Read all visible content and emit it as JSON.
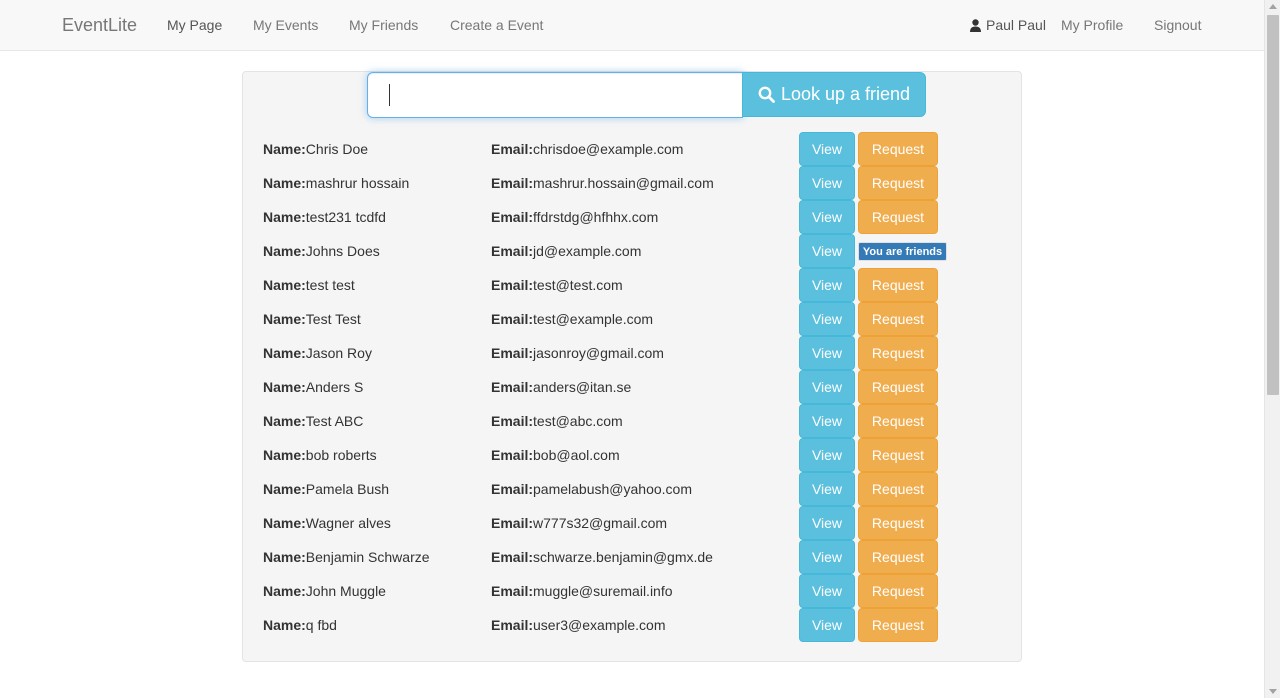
{
  "nav": {
    "brand": "EventLite",
    "links": [
      "My Page",
      "My Events",
      "My Friends",
      "Create a Event"
    ],
    "user": "Paul Paul",
    "profile": "My Profile",
    "signout": "Signout"
  },
  "search": {
    "value": "",
    "button_label": "Look up a friend"
  },
  "labels": {
    "name": "Name:",
    "email": "Email:",
    "view": "View",
    "request": "Request",
    "friends_badge": "You are friends"
  },
  "people": [
    {
      "name": "Chris Doe",
      "email": "chrisdoe@example.com",
      "friend": false
    },
    {
      "name": "mashrur hossain",
      "email": "mashrur.hossain@gmail.com",
      "friend": false
    },
    {
      "name": "test231 tcdfd",
      "email": "ffdrstdg@hfhhx.com",
      "friend": false
    },
    {
      "name": "Johns Does",
      "email": "jd@example.com",
      "friend": true
    },
    {
      "name": "test test",
      "email": "test@test.com",
      "friend": false
    },
    {
      "name": "Test Test",
      "email": "test@example.com",
      "friend": false
    },
    {
      "name": "Jason Roy",
      "email": "jasonroy@gmail.com",
      "friend": false
    },
    {
      "name": "Anders S",
      "email": "anders@itan.se",
      "friend": false
    },
    {
      "name": "Test ABC",
      "email": "test@abc.com",
      "friend": false
    },
    {
      "name": "bob roberts",
      "email": "bob@aol.com",
      "friend": false
    },
    {
      "name": "Pamela Bush",
      "email": "pamelabush@yahoo.com",
      "friend": false
    },
    {
      "name": "Wagner alves",
      "email": "w777s32@gmail.com",
      "friend": false
    },
    {
      "name": "Benjamin Schwarze",
      "email": "schwarze.benjamin@gmx.de",
      "friend": false
    },
    {
      "name": "John Muggle",
      "email": "muggle@suremail.info",
      "friend": false
    },
    {
      "name": "q fbd",
      "email": "user3@example.com",
      "friend": false
    }
  ],
  "colors": {
    "info": "#5bc0de",
    "warning": "#f0ad4e",
    "primary": "#337ab7"
  }
}
